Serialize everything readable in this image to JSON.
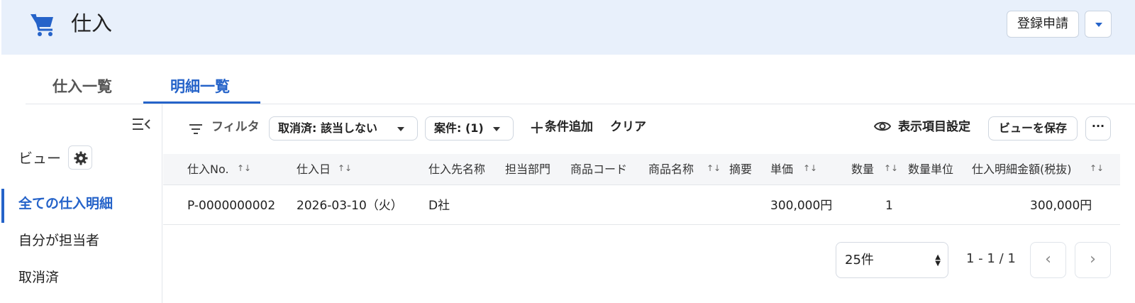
{
  "header": {
    "title": "仕入",
    "icon": "cart-icon",
    "register_button": "登録申請",
    "accent_color": "#2563c9"
  },
  "tabs": [
    {
      "label": "仕入一覧",
      "active": false
    },
    {
      "label": "明細一覧",
      "active": true
    }
  ],
  "sidebar": {
    "view_label": "ビュー",
    "items": [
      {
        "label": "全ての仕入明細",
        "active": true
      },
      {
        "label": "自分が担当者",
        "active": false
      },
      {
        "label": "取消済",
        "active": false
      }
    ]
  },
  "toolbar": {
    "filter_label": "フィルタ",
    "chips": [
      "取消済: 該当しない",
      "案件: (1)"
    ],
    "add_condition": "条件追加",
    "clear": "クリア",
    "display_settings": "表示項目設定",
    "save_view": "ビューを保存",
    "more": "···"
  },
  "table": {
    "columns": [
      "仕入No.",
      "仕入日",
      "仕入先名称",
      "担当部門",
      "商品コード",
      "商品名称",
      "摘要",
      "単価",
      "数量",
      "数量単位",
      "仕入明細金額(税抜)"
    ],
    "rows": [
      [
        "P-0000000002",
        "2026-03-10（火）",
        "D社",
        "",
        "",
        "",
        "",
        "300,000円",
        "1",
        "",
        "300,000円"
      ]
    ]
  },
  "pagination": {
    "page_size": "25件",
    "count": "1 - 1 / 1",
    "prev": "‹",
    "next": "›"
  }
}
